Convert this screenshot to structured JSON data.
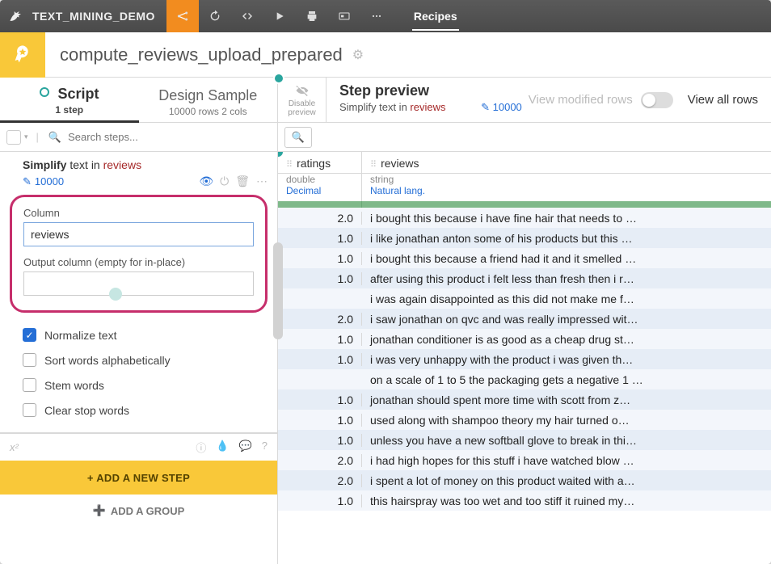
{
  "topbar": {
    "project": "TEXT_MINING_DEMO",
    "recipes": "Recipes"
  },
  "recipe": {
    "name": "compute_reviews_upload_prepared"
  },
  "leftTabs": {
    "script": {
      "title": "Script",
      "sub": "1 step"
    },
    "design": {
      "title": "Design Sample",
      "sub": "10000 rows 2 cols"
    }
  },
  "search": {
    "placeholder": "Search steps..."
  },
  "step": {
    "action": "Simplify",
    "object": "text in",
    "column": "reviews",
    "count": "10000"
  },
  "config": {
    "columnLabel": "Column",
    "columnValue": "reviews",
    "outputLabel": "Output column (empty for in-place)",
    "outputValue": ""
  },
  "checks": {
    "normalize": "Normalize text",
    "sort": "Sort words alphabetically",
    "stem": "Stem words",
    "stop": "Clear stop words"
  },
  "buttons": {
    "addStep": "+ ADD A NEW STEP",
    "addGroup": "ADD A GROUP"
  },
  "preview": {
    "disable": "Disable preview",
    "title": "Step preview",
    "sub1": "Simplify text in ",
    "subCol": "reviews",
    "count": "10000",
    "viewMod": "View modified rows",
    "viewAll": "View all rows"
  },
  "columns": {
    "ratings": {
      "name": "ratings",
      "type": "double",
      "meaning": "Decimal"
    },
    "reviews": {
      "name": "reviews",
      "type": "string",
      "meaning": "Natural lang."
    }
  },
  "rows": [
    {
      "r": "2.0",
      "t": "i bought this because i have fine hair that needs to …"
    },
    {
      "r": "1.0",
      "t": "i like jonathan anton some of his products but this …"
    },
    {
      "r": "1.0",
      "t": "i bought this because a friend had it and it smelled …"
    },
    {
      "r": "1.0",
      "t": "after using this product i felt less than fresh then i r…"
    },
    {
      "r": "",
      "t": "i was again disappointed as this did not make me f…"
    },
    {
      "r": "2.0",
      "t": "i saw jonathan on qvc and was really impressed wit…"
    },
    {
      "r": "1.0",
      "t": "jonathan conditioner is as good as a cheap drug st…"
    },
    {
      "r": "1.0",
      "t": "i was very unhappy with the product i was given th…"
    },
    {
      "r": "",
      "t": "on a scale of 1 to 5 the packaging gets a negative 1 …"
    },
    {
      "r": "1.0",
      "t": "jonathan should spent more time with scott from z…"
    },
    {
      "r": "1.0",
      "t": "used along with shampoo theory my hair turned o…"
    },
    {
      "r": "1.0",
      "t": "unless you have a new softball glove to break in thi…"
    },
    {
      "r": "2.0",
      "t": "i had high hopes for this stuff i have watched blow …"
    },
    {
      "r": "2.0",
      "t": "i spent a lot of money on this product waited with a…"
    },
    {
      "r": "1.0",
      "t": "this hairspray was too wet and too stiff it ruined my…"
    }
  ]
}
